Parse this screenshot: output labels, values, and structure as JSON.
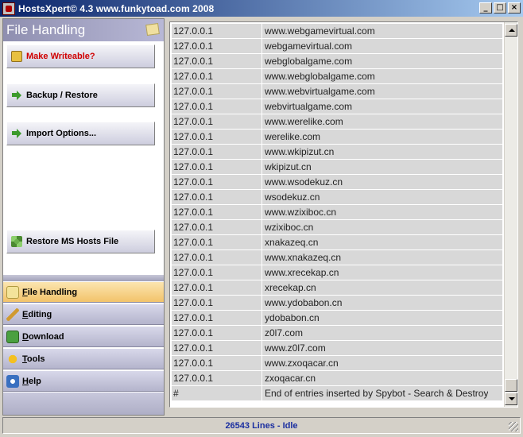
{
  "window": {
    "title": "HostsXpert© 4.3  www.funkytoad.com 2008",
    "min_label": "_",
    "max_label": "□",
    "close_label": "×"
  },
  "left_panel": {
    "section_title": "File Handling",
    "actions": [
      {
        "label": "Make Writeable?",
        "icon": "lock-icon",
        "color": "#d00000"
      },
      {
        "label": "Backup / Restore",
        "icon": "arrow-right-icon"
      },
      {
        "label": "Import Options...",
        "icon": "arrow-right-icon"
      },
      {
        "label": "Restore MS Hosts File",
        "icon": "restore-icon"
      }
    ],
    "nav": [
      {
        "label": "File Handling",
        "icon": "folder-icon",
        "active": true
      },
      {
        "label": "Editing",
        "icon": "pencil-icon"
      },
      {
        "label": "Download",
        "icon": "download-icon"
      },
      {
        "label": "Tools",
        "icon": "tools-icon"
      },
      {
        "label": "Help",
        "icon": "help-icon"
      }
    ]
  },
  "hosts_list": {
    "rows": [
      {
        "ip": "127.0.0.1",
        "host": "www.webgamevirtual.com"
      },
      {
        "ip": "127.0.0.1",
        "host": "webgamevirtual.com"
      },
      {
        "ip": "127.0.0.1",
        "host": "webglobalgame.com"
      },
      {
        "ip": "127.0.0.1",
        "host": "www.webglobalgame.com"
      },
      {
        "ip": "127.0.0.1",
        "host": "www.webvirtualgame.com"
      },
      {
        "ip": "127.0.0.1",
        "host": "webvirtualgame.com"
      },
      {
        "ip": "127.0.0.1",
        "host": "www.werelike.com"
      },
      {
        "ip": "127.0.0.1",
        "host": "werelike.com"
      },
      {
        "ip": "127.0.0.1",
        "host": "www.wkipizut.cn"
      },
      {
        "ip": "127.0.0.1",
        "host": "wkipizut.cn"
      },
      {
        "ip": "127.0.0.1",
        "host": "www.wsodekuz.cn"
      },
      {
        "ip": "127.0.0.1",
        "host": "wsodekuz.cn"
      },
      {
        "ip": "127.0.0.1",
        "host": "www.wzixiboc.cn"
      },
      {
        "ip": "127.0.0.1",
        "host": "wzixiboc.cn"
      },
      {
        "ip": "127.0.0.1",
        "host": "xnakazeq.cn"
      },
      {
        "ip": "127.0.0.1",
        "host": "www.xnakazeq.cn"
      },
      {
        "ip": "127.0.0.1",
        "host": "www.xrecekap.cn"
      },
      {
        "ip": "127.0.0.1",
        "host": "xrecekap.cn"
      },
      {
        "ip": "127.0.0.1",
        "host": "www.ydobabon.cn"
      },
      {
        "ip": "127.0.0.1",
        "host": "ydobabon.cn"
      },
      {
        "ip": "127.0.0.1",
        "host": "z0l7.com"
      },
      {
        "ip": "127.0.0.1",
        "host": "www.z0l7.com"
      },
      {
        "ip": "127.0.0.1",
        "host": "www.zxoqacar.cn"
      },
      {
        "ip": "127.0.0.1",
        "host": "zxoqacar.cn"
      },
      {
        "ip": "#",
        "host": "End of entries inserted by Spybot - Search & Destroy"
      }
    ]
  },
  "status": {
    "text": "26543 Lines - Idle",
    "color": "#1a2ea0"
  }
}
